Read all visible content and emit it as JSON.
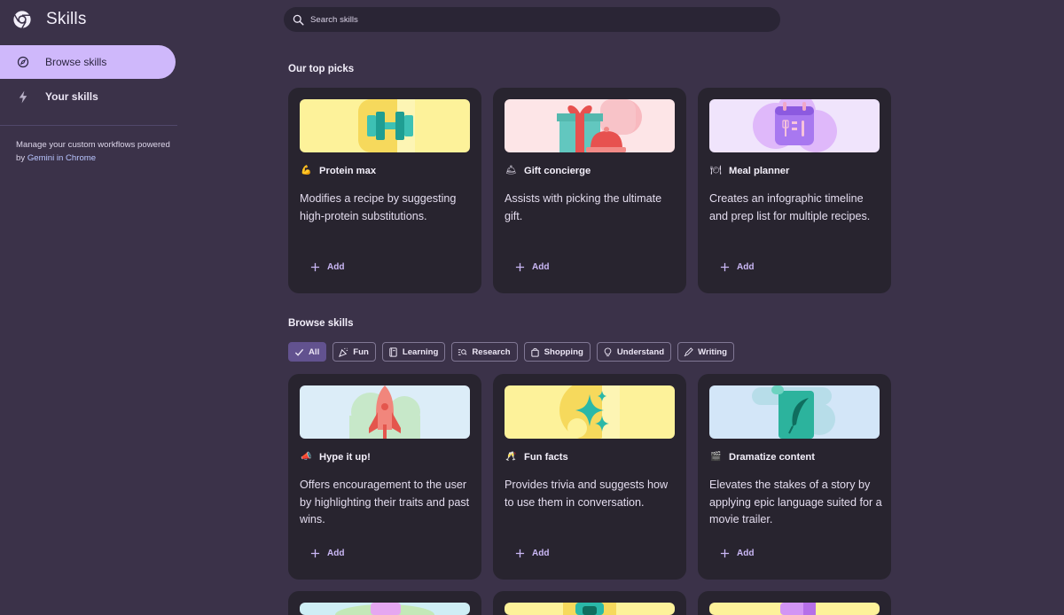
{
  "app": {
    "title": "Skills"
  },
  "sidebar": {
    "items": [
      {
        "label": "Browse skills",
        "icon": "compass-icon"
      },
      {
        "label": "Your skills",
        "icon": "lightning-icon"
      }
    ],
    "note_text": "Manage your custom workflows powered by",
    "note_link": "Gemini in Chrome"
  },
  "search": {
    "placeholder": "Search skills"
  },
  "top_picks": {
    "title": "Our top picks",
    "cards": [
      {
        "emoji": "💪",
        "title": "Protein max",
        "description": "Modifies a recipe by suggesting high-protein substitutions.",
        "add_label": "Add",
        "icon": "dumbbell-icon"
      },
      {
        "emoji": "🛎",
        "title": "Gift concierge",
        "description": "Assists with picking the ultimate gift.",
        "add_label": "Add",
        "icon": "gift-icon"
      },
      {
        "emoji": "🍽",
        "title": "Meal planner",
        "description": "Creates an infographic timeline and prep list for multiple recipes.",
        "add_label": "Add",
        "icon": "calendar-icon"
      }
    ]
  },
  "browse": {
    "title": "Browse skills",
    "chips": [
      {
        "label": "All",
        "icon": "check-icon",
        "active": true
      },
      {
        "label": "Fun",
        "icon": "party-icon"
      },
      {
        "label": "Learning",
        "icon": "book-icon"
      },
      {
        "label": "Research",
        "icon": "search-list-icon"
      },
      {
        "label": "Shopping",
        "icon": "shopping-bag-icon"
      },
      {
        "label": "Understand",
        "icon": "lightbulb-icon"
      },
      {
        "label": "Writing",
        "icon": "pen-icon"
      }
    ],
    "cards": [
      {
        "emoji": "📣",
        "title": "Hype it up!",
        "description": "Offers encouragement to the user by highlighting their traits and past wins.",
        "add_label": "Add",
        "icon": "rocket-icon"
      },
      {
        "emoji": "🥂",
        "title": "Fun facts",
        "description": "Provides trivia and suggests how to use them in conversation.",
        "add_label": "Add",
        "icon": "sparkles-icon"
      },
      {
        "emoji": "🎬",
        "title": "Dramatize content",
        "description": "Elevates the stakes of a story by applying epic language suited for a movie trailer.",
        "add_label": "Add",
        "icon": "scroll-quill-icon"
      }
    ]
  },
  "colors": {
    "accent": "#cfb8fb",
    "background": "#3b3249",
    "card": "#28242f",
    "chip_active": "#62528f"
  }
}
